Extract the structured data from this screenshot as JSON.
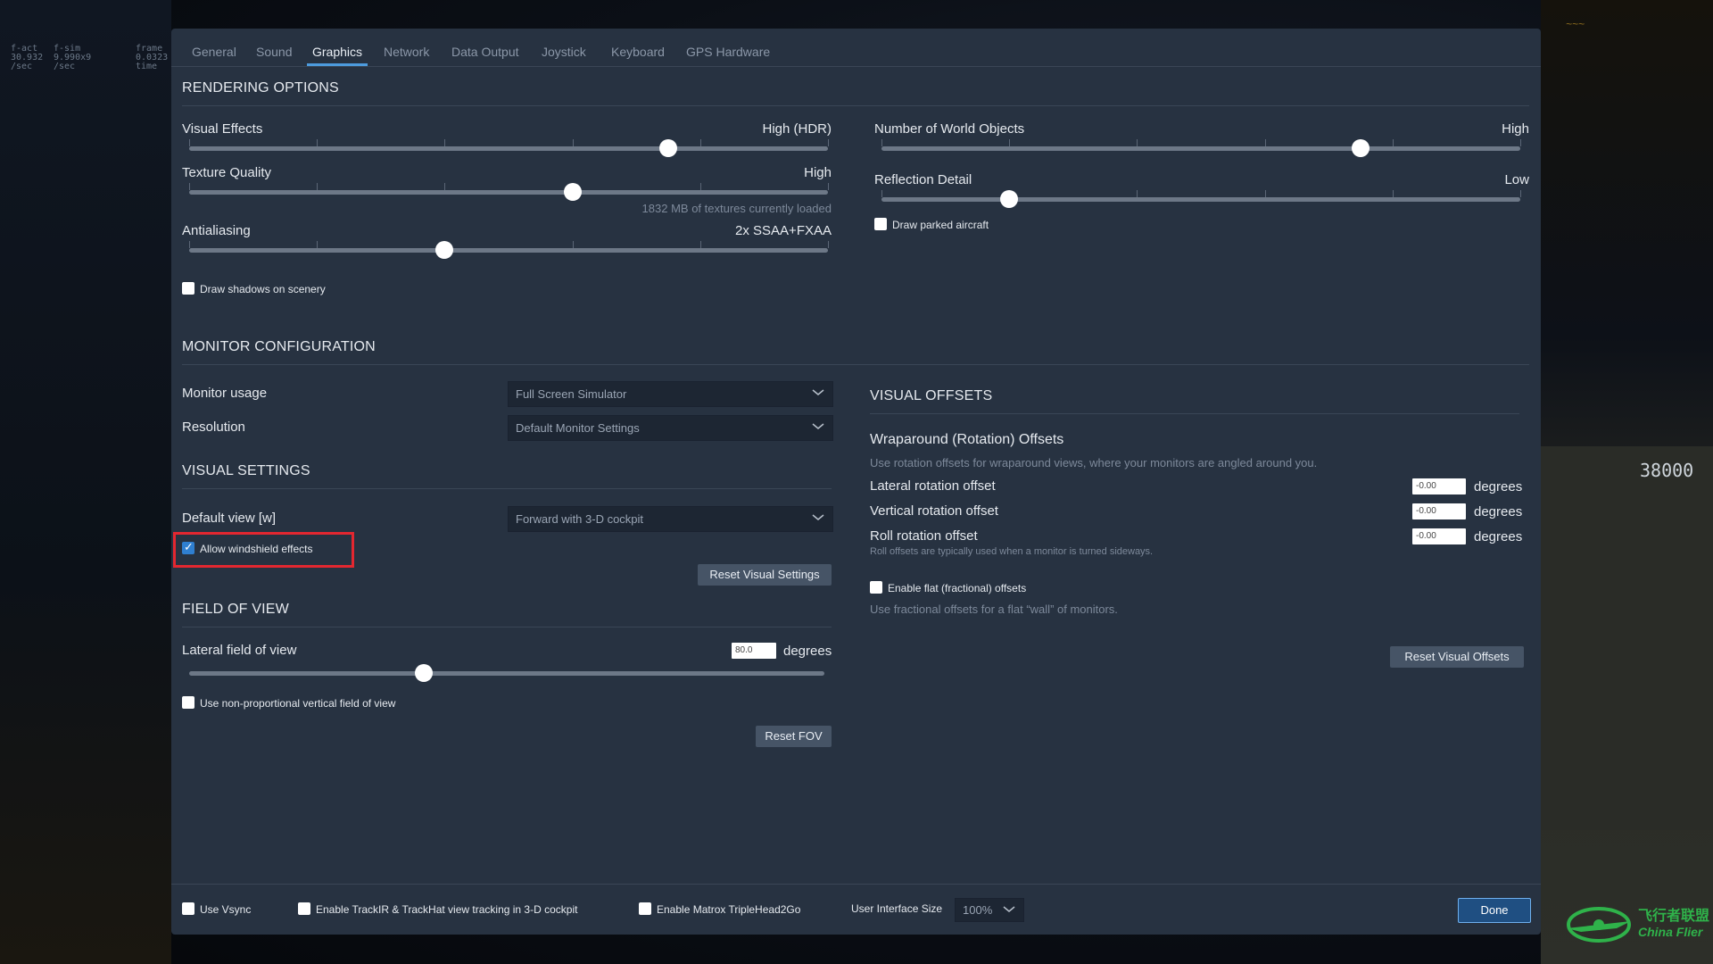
{
  "hud": {
    "col1": [
      "f-act",
      "30.932",
      "/sec"
    ],
    "col2": [
      "f-sim",
      "9.990x9",
      "/sec"
    ],
    "col3": [
      "frame",
      "0.0323",
      "time"
    ]
  },
  "watermark": {
    "cn": "飞行者联盟",
    "en": "China Flier"
  },
  "cockpit_readout": "38000",
  "tabs": [
    "General",
    "Sound",
    "Graphics",
    "Network",
    "Data Output",
    "Joystick",
    "Keyboard",
    "GPS Hardware"
  ],
  "rendering": {
    "title": "RENDERING OPTIONS",
    "visual_effects": {
      "label": "Visual Effects",
      "value": "High (HDR)",
      "level": 0.75
    },
    "texture_quality": {
      "label": "Texture Quality",
      "value": "High",
      "level": 0.6,
      "note": "1832 MB of textures currently loaded"
    },
    "antialiasing": {
      "label": "Antialiasing",
      "value": "2x SSAA+FXAA",
      "level": 0.4
    },
    "draw_shadows": {
      "label": "Draw shadows on scenery",
      "checked": false
    },
    "world_objects": {
      "label": "Number of World Objects",
      "value": "High",
      "level": 0.75
    },
    "reflection_detail": {
      "label": "Reflection Detail",
      "value": "Low",
      "level": 0.2
    },
    "draw_parked": {
      "label": "Draw parked aircraft",
      "checked": false
    }
  },
  "monitor": {
    "title": "MONITOR CONFIGURATION",
    "usage_label": "Monitor usage",
    "usage_value": "Full Screen Simulator",
    "resolution_label": "Resolution",
    "resolution_value": "Default Monitor Settings"
  },
  "visual_settings": {
    "title": "VISUAL SETTINGS",
    "default_view_label": "Default view [w]",
    "default_view_value": "Forward with 3-D cockpit",
    "windshield": {
      "label": "Allow windshield effects",
      "checked": true
    },
    "reset_label": "Reset Visual Settings"
  },
  "fov": {
    "title": "FIELD OF VIEW",
    "lateral_label": "Lateral field of view",
    "lateral_value": "80.0",
    "unit": "degrees",
    "level": 0.37,
    "nonprop": {
      "label": "Use non-proportional vertical field of view",
      "checked": false
    },
    "reset_label": "Reset FOV"
  },
  "visual_offsets": {
    "title": "VISUAL OFFSETS",
    "wrap_title": "Wraparound (Rotation) Offsets",
    "wrap_desc": "Use rotation offsets for wraparound views, where your monitors are angled around you.",
    "lateral": {
      "label": "Lateral rotation offset",
      "value": "-0.00",
      "unit": "degrees"
    },
    "vertical": {
      "label": "Vertical rotation offset",
      "value": "-0.00",
      "unit": "degrees"
    },
    "roll": {
      "label": "Roll rotation offset",
      "value": "-0.00",
      "unit": "degrees",
      "note": "Roll offsets are typically used when a monitor is turned sideways."
    },
    "flat": {
      "label": "Enable flat (fractional) offsets",
      "checked": false,
      "desc": "Use fractional offsets for a flat “wall” of monitors."
    },
    "reset_label": "Reset Visual Offsets"
  },
  "footer": {
    "vsync": {
      "label": "Use Vsync",
      "checked": false
    },
    "trackir": {
      "label": "Enable TrackIR & TrackHat view tracking in 3-D cockpit",
      "checked": false
    },
    "matrox": {
      "label": "Enable Matrox TripleHead2Go",
      "checked": false
    },
    "ui_size_label": "User Interface Size",
    "ui_size_value": "100%",
    "done_label": "Done"
  }
}
